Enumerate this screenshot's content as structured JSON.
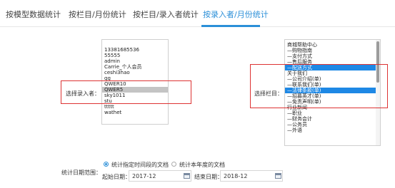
{
  "tabs": [
    {
      "label": "按模型数据统计",
      "active": false
    },
    {
      "label": "按栏目/月份统计",
      "active": false
    },
    {
      "label": "按栏目/录入者统计",
      "active": false
    },
    {
      "label": "按录入者/月份统计",
      "active": true
    }
  ],
  "recorder": {
    "label": "选择录入者：",
    "options": [
      {
        "text": "13381685536",
        "state": "normal"
      },
      {
        "text": "55555",
        "state": "normal"
      },
      {
        "text": "admin",
        "state": "normal"
      },
      {
        "text": "Carrie_个人会员",
        "state": "normal"
      },
      {
        "text": "ceshi3hao",
        "state": "normal"
      },
      {
        "text": "gg",
        "state": "normal"
      },
      {
        "text": "QWER10",
        "state": "normal"
      },
      {
        "text": "QWER5",
        "state": "grey"
      },
      {
        "text": "sky1011",
        "state": "normal"
      },
      {
        "text": "stu",
        "state": "normal"
      },
      {
        "text": "ttttt",
        "state": "normal"
      },
      {
        "text": "wathet",
        "state": "normal"
      }
    ]
  },
  "column": {
    "label": "选择栏目：",
    "options": [
      {
        "text": "商城帮助中心",
        "state": "normal"
      },
      {
        "text": "—购物指南",
        "state": "normal"
      },
      {
        "text": "—支付方式",
        "state": "normal"
      },
      {
        "text": "—售后服务",
        "state": "normal"
      },
      {
        "text": "—配送方式",
        "state": "sel"
      },
      {
        "text": "关于我们",
        "state": "normal"
      },
      {
        "text": "—公司介绍(单)",
        "state": "normal"
      },
      {
        "text": "—联系我们(单)",
        "state": "normal"
      },
      {
        "text": "—法律条款(单)",
        "state": "sel"
      },
      {
        "text": "—招募英才(单)",
        "state": "normal"
      },
      {
        "text": "—免责声明(单)",
        "state": "normal"
      },
      {
        "text": "行业新闻",
        "state": "normal"
      },
      {
        "text": "—职业",
        "state": "normal"
      },
      {
        "text": "—财务会计",
        "state": "normal"
      },
      {
        "text": "—公务员",
        "state": "normal"
      },
      {
        "text": "—外语",
        "state": "normal"
      }
    ]
  },
  "date_range": {
    "label": "统计日期范围：",
    "option_specified": "统计指定时间段的文档",
    "option_year": "统计本年度的文档",
    "selected": "specified",
    "start_label": "起始日期：",
    "start_value": "2017-12",
    "end_label": "结束日期：",
    "end_value": "2018-12"
  },
  "colors": {
    "accent": "#2b8fd8",
    "highlight": "#d33333",
    "selected": "#1e88e5"
  }
}
